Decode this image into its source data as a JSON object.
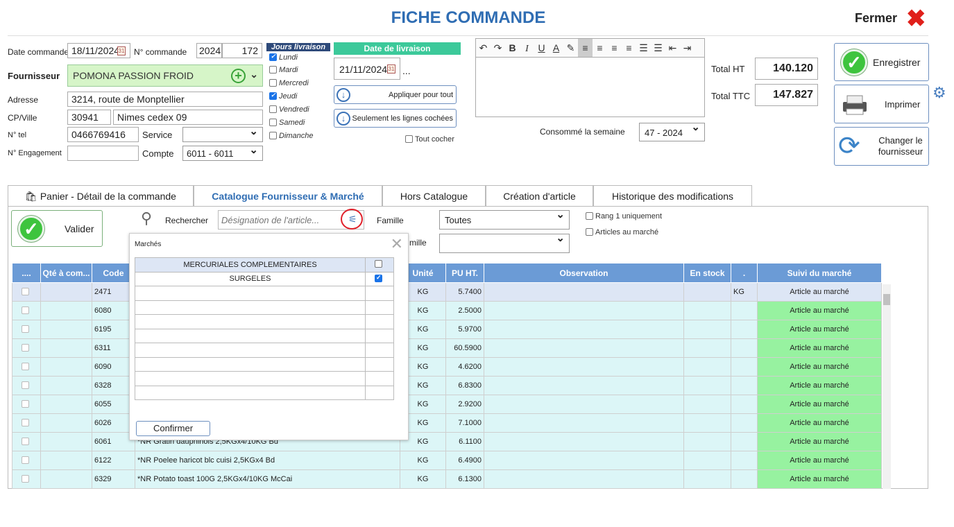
{
  "header": {
    "title": "FICHE COMMANDE",
    "close_label": "Fermer",
    "close_icon": "✖"
  },
  "form": {
    "date_commande_label": "Date commande",
    "date_commande": "18/11/2024",
    "num_commande_label": "N° commande",
    "num_commande_year": "2024",
    "num_commande_num": "172",
    "fournisseur_label": "Fournisseur",
    "fournisseur": "POMONA PASSION FROID",
    "adresse_label": "Adresse",
    "adresse": "3214, route de Monptellier",
    "cpville_label": "CP/Ville",
    "cp": "30941",
    "ville": "Nimes cedex 09",
    "tel_label": "N° tel",
    "tel": "0466769416",
    "service_label": "Service",
    "service": "",
    "engagement_label": "N° Engagement",
    "engagement": "",
    "compte_label": "Compte",
    "compte": "6011 - 6011"
  },
  "jours": {
    "title": "Jours livraison",
    "days": [
      {
        "label": "Lundi",
        "checked": true
      },
      {
        "label": "Mardi",
        "checked": false
      },
      {
        "label": "Mercredi",
        "checked": false
      },
      {
        "label": "Jeudi",
        "checked": true
      },
      {
        "label": "Vendredi",
        "checked": false
      },
      {
        "label": "Samedi",
        "checked": false
      },
      {
        "label": "Dimanche",
        "checked": false
      }
    ]
  },
  "livraison": {
    "title": "Date de livraison",
    "date": "21/11/2024",
    "ellipsis": "...",
    "apply_all": "Appliquer pour tout",
    "apply_checked": "Seulement les lignes cochées",
    "tout_cocher": "Tout cocher"
  },
  "conso": {
    "label": "Consommé la semaine",
    "value": "47 - 2024"
  },
  "totals": {
    "ht_label": "Total HT",
    "ht": "140.120",
    "ttc_label": "Total TTC",
    "ttc": "147.827"
  },
  "actions": {
    "save": "Enregistrer",
    "print": "Imprimer",
    "change_line1": "Changer le",
    "change_line2": "fournisseur"
  },
  "tabs": [
    "Panier - Détail de la commande",
    "Catalogue Fournisseur & Marché",
    "Hors Catalogue",
    "Création d'article",
    "Historique des modifications"
  ],
  "toolbar": {
    "valider": "Valider",
    "rechercher": "Rechercher",
    "search_placeholder": "Désignation de l'article...",
    "famille_label": "Famille",
    "famille": "Toutes",
    "sousfamille_label": "mille",
    "rang1": "Rang 1 uniquement",
    "marche": "Articles au marché"
  },
  "table": {
    "columns": [
      "....",
      "Qté à com...",
      "Code",
      "",
      "Unité",
      "PU HT.",
      "Observation",
      "En stock",
      ".",
      "Suivi du marché"
    ],
    "rows": [
      {
        "code": "2471",
        "designation": "",
        "unite": "KG",
        "pu": "5.7400",
        "extra": "KG",
        "suivi": "Article au marché"
      },
      {
        "code": "6080",
        "designation": "",
        "unite": "KG",
        "pu": "2.5000",
        "extra": "",
        "suivi": "Article au marché"
      },
      {
        "code": "6195",
        "designation": "",
        "unite": "KG",
        "pu": "5.9700",
        "extra": "",
        "suivi": "Article au marché"
      },
      {
        "code": "6311",
        "designation": "",
        "unite": "KG",
        "pu": "60.5900",
        "extra": "",
        "suivi": "Article au marché"
      },
      {
        "code": "6090",
        "designation": "",
        "unite": "KG",
        "pu": "4.6200",
        "extra": "",
        "suivi": "Article au marché"
      },
      {
        "code": "6328",
        "designation": "",
        "unite": "KG",
        "pu": "6.8300",
        "extra": "",
        "suivi": "Article au marché"
      },
      {
        "code": "6055",
        "designation": "",
        "unite": "KG",
        "pu": "2.9200",
        "extra": "",
        "suivi": "Article au marché"
      },
      {
        "code": "6026",
        "designation": "",
        "unite": "KG",
        "pu": "7.1000",
        "extra": "",
        "suivi": "Article au marché"
      },
      {
        "code": "6061",
        "designation": "*NR Gratin dauphinois 2,5KGx4/10KG Bd",
        "unite": "KG",
        "pu": "6.1100",
        "extra": "",
        "suivi": "Article au marché"
      },
      {
        "code": "6122",
        "designation": "*NR Poelee haricot blc cuisi 2,5KGx4 Bd",
        "unite": "KG",
        "pu": "6.4900",
        "extra": "",
        "suivi": "Article au marché"
      },
      {
        "code": "6329",
        "designation": "*NR Potato toast 100G 2,5KGx4/10KG McCai",
        "unite": "KG",
        "pu": "6.1300",
        "extra": "",
        "suivi": "Article au marché"
      }
    ]
  },
  "popup": {
    "title": "Marchés",
    "markets": [
      {
        "name": "MERCURIALES COMPLEMENTAIRES",
        "checked": false
      },
      {
        "name": "SURGELES",
        "checked": true
      }
    ],
    "confirm": "Confirmer"
  }
}
